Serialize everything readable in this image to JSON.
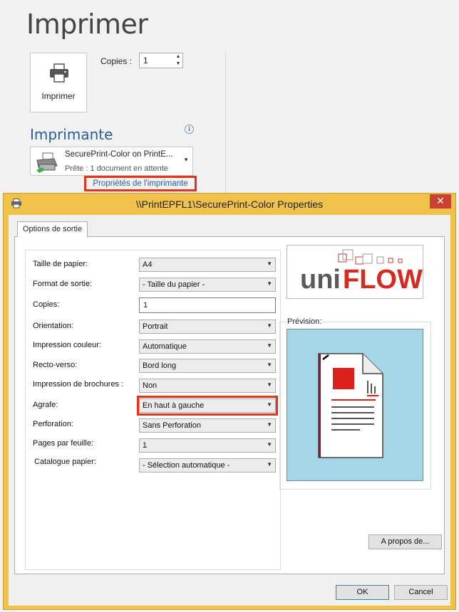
{
  "backstage": {
    "title": "Imprimer",
    "print_button_label": "Imprimer",
    "copies_label": "Copies :",
    "copies_value": "1",
    "printer_section_title": "Imprimante",
    "printer_name": "SecurePrint-Color on PrintE...",
    "printer_status": "Prête : 1 document en attente",
    "printer_properties_link": "Propriétés de l'imprimante",
    "info_icon_glyph": "i"
  },
  "dialog": {
    "title": "\\\\PrintEPFL1\\SecurePrint-Color Properties",
    "close_glyph": "✕",
    "tab_label": "Options de sortie",
    "fields": [
      {
        "label": "Taille de papier:",
        "value": "A4",
        "kind": "combo"
      },
      {
        "label": "Format de sortie:",
        "value": "- Taille du papier -",
        "kind": "combo"
      },
      {
        "label": "Copies:",
        "value": "1",
        "kind": "text"
      },
      {
        "label": "Orientation:",
        "value": "Portrait",
        "kind": "combo"
      },
      {
        "label": "Impression couleur:",
        "value": "Automatique",
        "kind": "combo"
      },
      {
        "label": "Recto-verso:",
        "value": "Bord long",
        "kind": "combo"
      },
      {
        "label": "Impression de brochures :",
        "value": "Non",
        "kind": "combo"
      },
      {
        "label": "Agrafe:",
        "value": "En haut à gauche",
        "kind": "combo",
        "highlighted": true
      },
      {
        "label": "Perforation:",
        "value": "Sans Perforation",
        "kind": "combo"
      },
      {
        "label": "Pages par feuille:",
        "value": "1",
        "kind": "combo"
      },
      {
        "label": "Catalogue papier:",
        "value": "- Sélection automatique -",
        "kind": "combo"
      }
    ],
    "logo_text_uni": "uni",
    "logo_text_flow": "FLOW",
    "preview_label": "Prévision:",
    "about_button": "A propos de...",
    "ok_button": "OK",
    "cancel_button": "Cancel"
  },
  "colors": {
    "dialog_frame": "#f0c24a",
    "highlight_red": "#e0341c",
    "section_blue": "#2c5c9b",
    "preview_background": "#a4d6e6",
    "staple_accent": "#d9201a"
  },
  "icons": [
    "printer-icon",
    "printer-icon-small",
    "info-icon",
    "dropdown-caret-icon",
    "close-icon",
    "uniflow-logo",
    "document-preview-icon"
  ]
}
